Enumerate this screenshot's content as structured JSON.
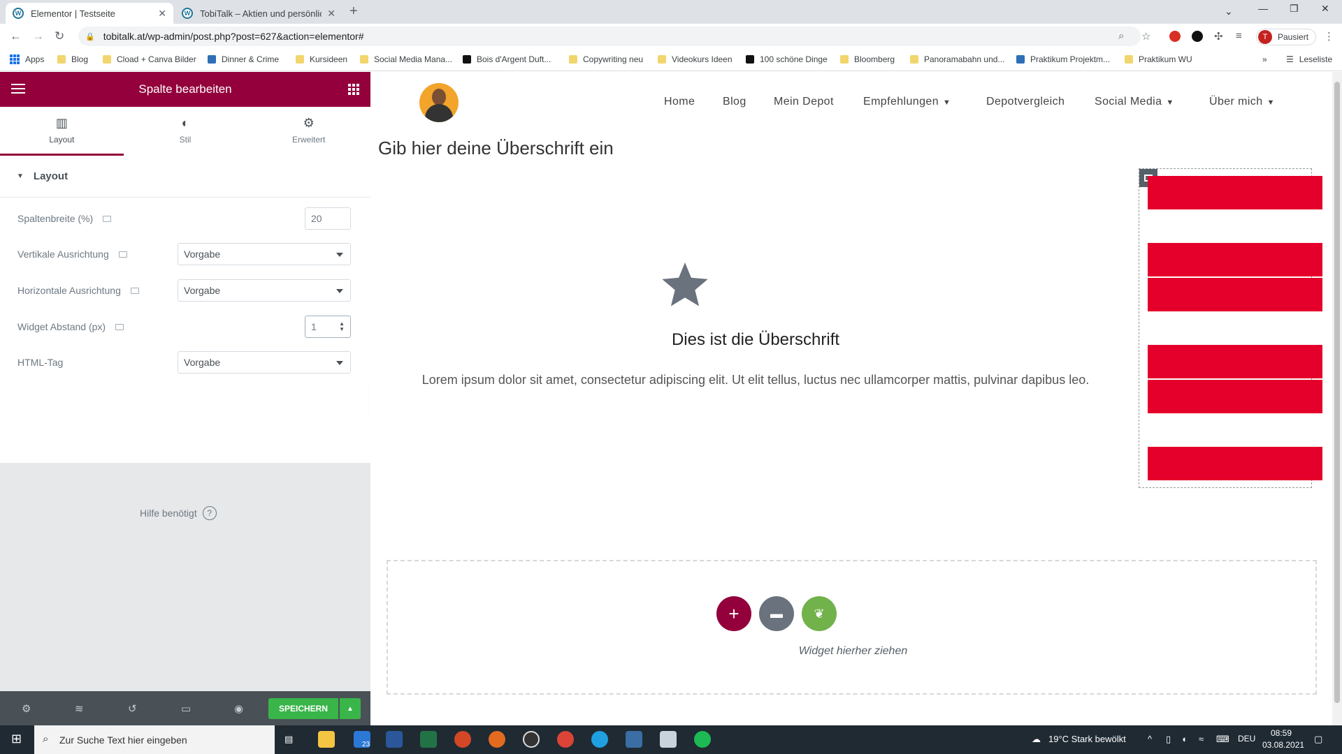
{
  "browser": {
    "tabs": [
      {
        "title": "Elementor | Testseite",
        "active": true
      },
      {
        "title": "TobiTalk – Aktien und persönliche",
        "active": false
      }
    ],
    "url": "tobitalk.at/wp-admin/post.php?post=627&action=elementor#",
    "profile_label": "Pausiert",
    "profile_initial": "T",
    "bookmarks": [
      "Apps",
      "Blog",
      "Cload + Canva Bilder",
      "Dinner & Crime",
      "Kursideen",
      "Social Media Mana...",
      "Bois d'Argent Duft...",
      "Copywriting neu",
      "Videokurs Ideen",
      "100 schöne Dinge",
      "Bloomberg",
      "Panoramabahn und...",
      "Praktikum Projektm...",
      "Praktikum WU"
    ],
    "reading_list": "Leseliste"
  },
  "panel": {
    "title": "Spalte bearbeiten",
    "tabs": [
      {
        "label": "Layout",
        "icon": "columns-icon"
      },
      {
        "label": "Stil",
        "icon": "contrast-icon"
      },
      {
        "label": "Erweitert",
        "icon": "gear-icon"
      }
    ],
    "section_title": "Layout",
    "controls": {
      "column_width_label": "Spaltenbreite (%)",
      "column_width_value": "20",
      "vertical_align_label": "Vertikale Ausrichtung",
      "vertical_align_value": "Vorgabe",
      "horizontal_align_label": "Horizontale Ausrichtung",
      "horizontal_align_value": "Vorgabe",
      "widget_spacing_label": "Widget Abstand (px)",
      "widget_spacing_value": "1",
      "html_tag_label": "HTML-Tag",
      "html_tag_value": "Vorgabe"
    },
    "help_text": "Hilfe benötigt",
    "save_label": "SPEICHERN"
  },
  "preview": {
    "menu": [
      "Home",
      "Blog",
      "Mein Depot",
      "Empfehlungen",
      "Depotvergleich",
      "Social Media",
      "Über mich"
    ],
    "page_heading": "Gib hier deine Überschrift ein",
    "icon_box_heading": "Dies ist die Überschrift",
    "icon_box_text": "Lorem ipsum dolor sit amet, consectetur adipiscing elit. Ut elit tellus, luctus nec ullamcorper mattis, pulvinar dapibus leo.",
    "drop_text": "Widget hierher ziehen",
    "flag_colors": [
      "#e4002b",
      "#ffffff"
    ]
  },
  "taskbar": {
    "search_placeholder": "Zur Suche Text hier eingeben",
    "mail_badge": "23",
    "weather": "19°C  Stark bewölkt",
    "lang": "DEU",
    "time": "08:59",
    "date": "03.08.2021"
  }
}
